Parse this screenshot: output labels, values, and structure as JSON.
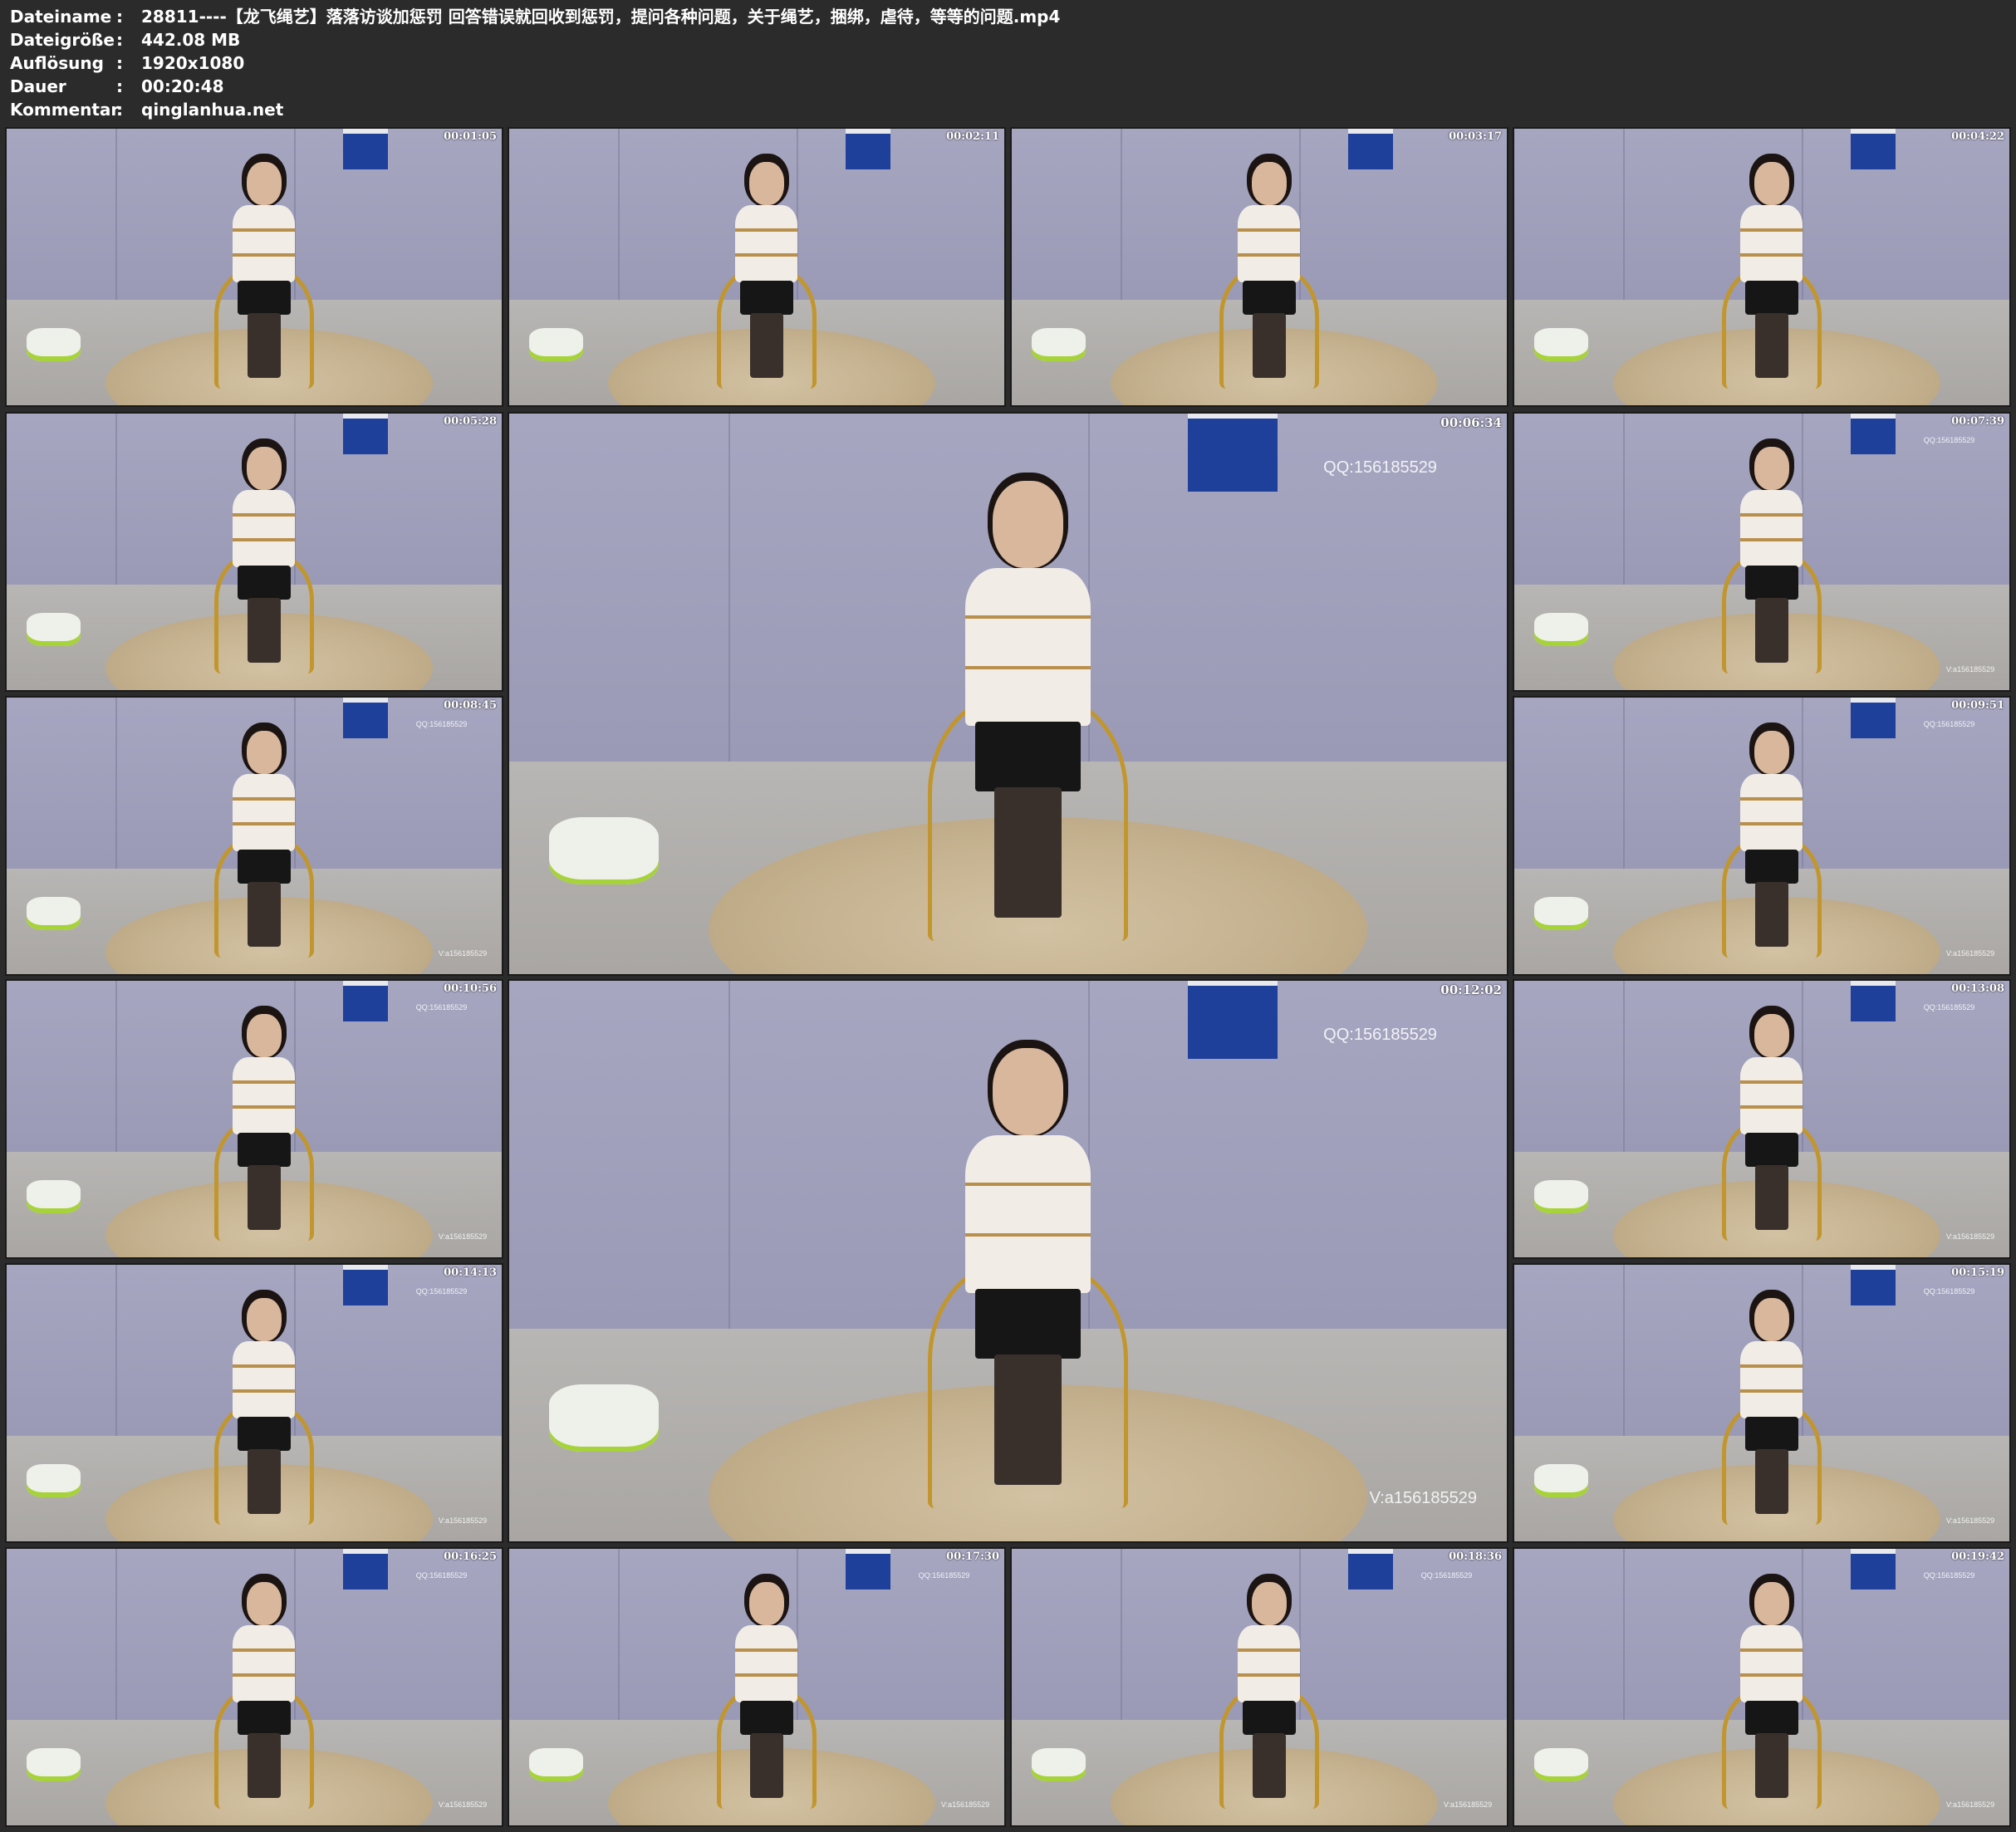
{
  "metadata": [
    {
      "key": "Dateiname",
      "sep": ":",
      "value": "28811----【龙飞绳艺】落落访谈加惩罚 回答错误就回收到惩罚，提问各种问题，关于绳艺，捆绑，虐待，等等的问题.mp4"
    },
    {
      "key": "Dateigröße",
      "sep": ":",
      "value": "442.08 MB"
    },
    {
      "key": "Auflösung",
      "sep": ":",
      "value": "1920x1080"
    },
    {
      "key": "Dauer",
      "sep": ":",
      "value": "00:20:48"
    },
    {
      "key": "Kommentar",
      "sep": ":",
      "value": "qinglanhua.net"
    }
  ],
  "thumbnails": [
    {
      "timecode": "00:01:05",
      "qq": "",
      "v": ""
    },
    {
      "timecode": "00:02:11",
      "qq": "",
      "v": ""
    },
    {
      "timecode": "00:03:17",
      "qq": "",
      "v": ""
    },
    {
      "timecode": "00:04:22",
      "qq": "",
      "v": ""
    },
    {
      "timecode": "00:05:28",
      "qq": "",
      "v": ""
    },
    {
      "timecode": "00:06:34",
      "qq": "QQ:156185529",
      "v": ""
    },
    {
      "timecode": "00:07:39",
      "qq": "QQ:156185529",
      "v": "V:a156185529"
    },
    {
      "timecode": "00:08:45",
      "qq": "QQ:156185529",
      "v": "V:a156185529"
    },
    {
      "timecode": "00:09:51",
      "qq": "QQ:156185529",
      "v": "V:a156185529"
    },
    {
      "timecode": "00:10:56",
      "qq": "QQ:156185529",
      "v": "V:a156185529"
    },
    {
      "timecode": "00:12:02",
      "qq": "QQ:156185529",
      "v": "V:a156185529"
    },
    {
      "timecode": "00:13:08",
      "qq": "QQ:156185529",
      "v": "V:a156185529"
    },
    {
      "timecode": "00:14:13",
      "qq": "QQ:156185529",
      "v": "V:a156185529"
    },
    {
      "timecode": "00:15:19",
      "qq": "QQ:156185529",
      "v": "V:a156185529"
    },
    {
      "timecode": "00:16:25",
      "qq": "QQ:156185529",
      "v": "V:a156185529"
    },
    {
      "timecode": "00:17:30",
      "qq": "QQ:156185529",
      "v": "V:a156185529"
    },
    {
      "timecode": "00:18:36",
      "qq": "QQ:156185529",
      "v": "V:a156185529"
    },
    {
      "timecode": "00:19:42",
      "qq": "QQ:156185529",
      "v": "V:a156185529"
    }
  ]
}
